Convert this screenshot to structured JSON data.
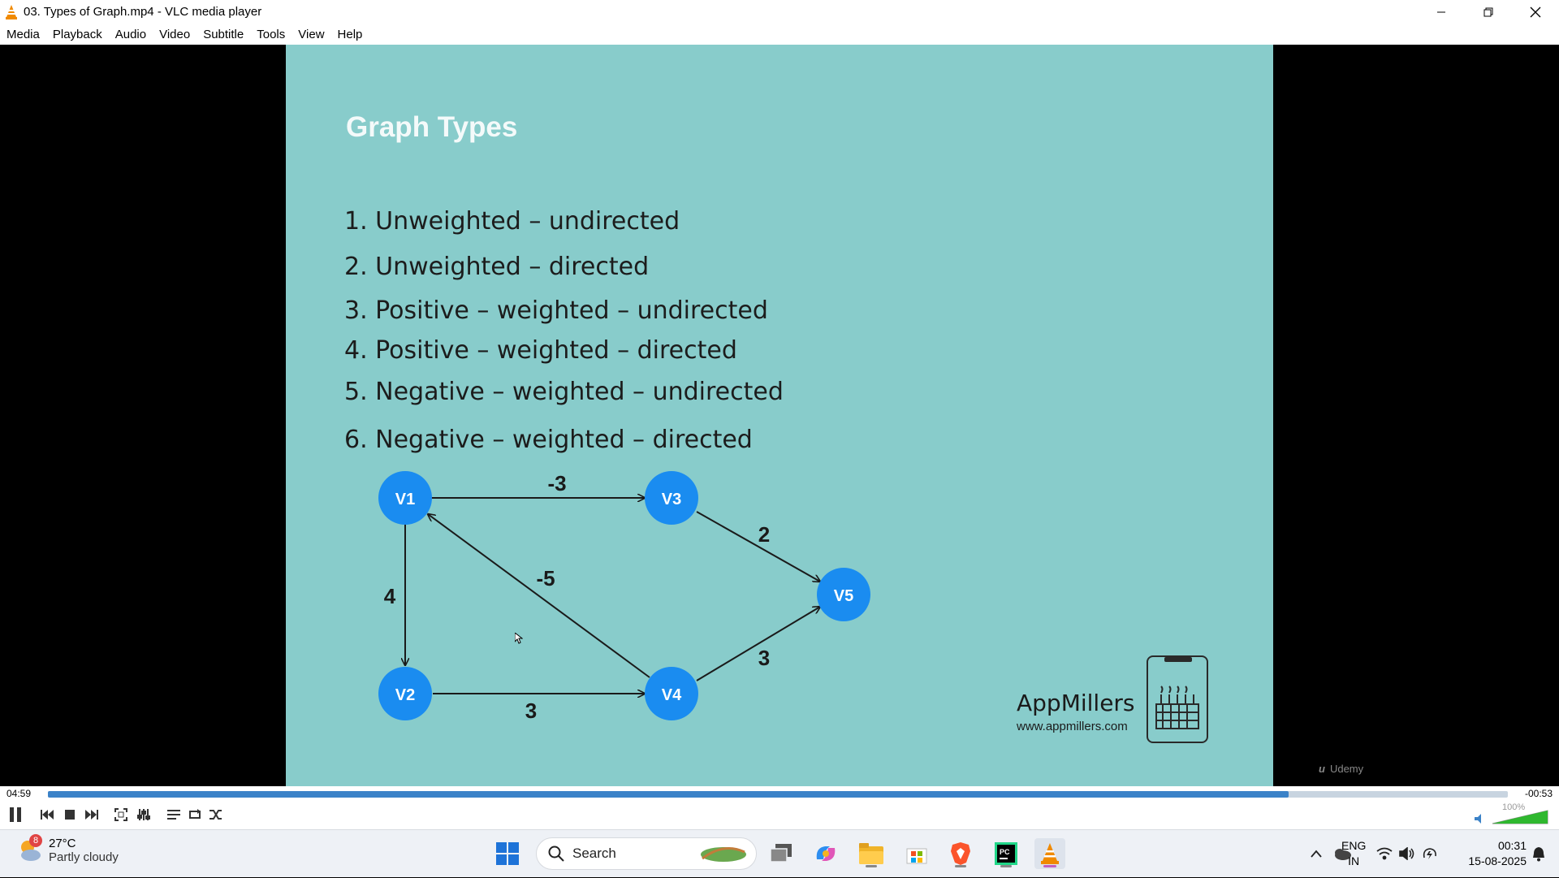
{
  "window": {
    "title": "03. Types of Graph.mp4 - VLC media player"
  },
  "menu": [
    "Media",
    "Playback",
    "Audio",
    "Video",
    "Subtitle",
    "Tools",
    "View",
    "Help"
  ],
  "slide": {
    "title": "Graph Types",
    "types": [
      "1. Unweighted – undirected",
      "2. Unweighted – directed",
      "3. Positive – weighted – undirected",
      "4. Positive – weighted – directed",
      "5. Negative – weighted – undirected",
      "6. Negative – weighted – directed"
    ],
    "graph": {
      "nodes": [
        "V1",
        "V2",
        "V3",
        "V4",
        "V5"
      ],
      "edges": [
        {
          "from": "V1",
          "to": "V3",
          "weight": "-3"
        },
        {
          "from": "V1",
          "to": "V2",
          "weight": "4"
        },
        {
          "from": "V4",
          "to": "V1",
          "weight": "-5"
        },
        {
          "from": "V2",
          "to": "V4",
          "weight": "3"
        },
        {
          "from": "V3",
          "to": "V5",
          "weight": "2"
        },
        {
          "from": "V4",
          "to": "V5",
          "weight": "3"
        }
      ]
    },
    "brand_name": "AppMillers",
    "brand_url": "www.appmillers.com",
    "watermark": "Udemy"
  },
  "player": {
    "elapsed": "04:59",
    "remaining": "-00:53",
    "progress_percent": 85,
    "volume_label": "100%",
    "volume_percent": 100
  },
  "taskbar": {
    "weather_badge": "8",
    "temperature": "27°C",
    "condition": "Partly cloudy",
    "search_label": "Search",
    "lang_top": "ENG",
    "lang_bottom": "IN",
    "time": "00:31",
    "date": "15-08-2025"
  },
  "colors": {
    "slide_bg": "#88cccb",
    "node_fill": "#1a8cf0",
    "seek_fill": "#3b82c8",
    "vlc_orange": "#f08a00"
  }
}
